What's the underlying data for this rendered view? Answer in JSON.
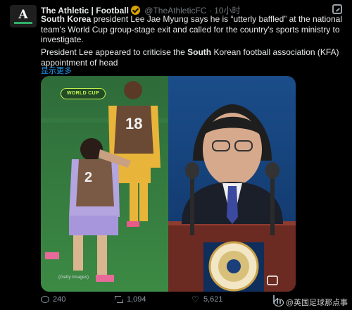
{
  "account": {
    "avatar_glyph": "A",
    "name": "The Athletic | Football",
    "handle": "@TheAthleticFC",
    "separator": "·",
    "time": "10小时"
  },
  "tweet": {
    "bold_1": "South Korea",
    "text_1": " president Lee Jae Myung says he is “utterly baffled” at the national team's World Cup group-stage exit and called for the country's sports ministry to investigate.",
    "para2_prefix": "President Lee appeared to criticise the ",
    "para2_bold": "South",
    "para2_suffix": " Korean football association (KFA) appointment of head",
    "show_more": "显示更多"
  },
  "media": {
    "badge": "WORLD CUP",
    "credit": "(Getty Images)",
    "jersey_numbers": [
      "18",
      "2"
    ]
  },
  "actions": {
    "replies": "240",
    "retweets": "1,094",
    "likes": "5,621"
  },
  "watermark": "@英国足球那点事",
  "colors": {
    "background": "#000000",
    "link": "#1d9bf0",
    "badge": "#c5f74f",
    "verified": "#d9a200"
  }
}
